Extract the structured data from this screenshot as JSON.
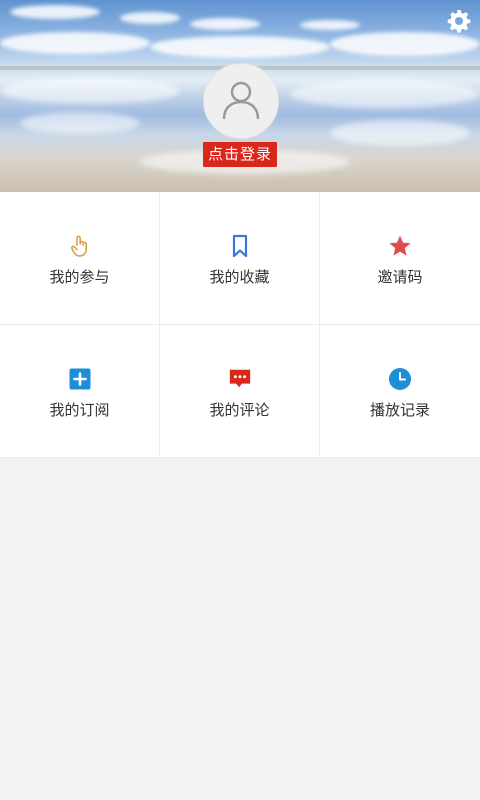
{
  "header": {
    "login_label": "点击登录",
    "accent_color": "#d9271c"
  },
  "menu": {
    "items": [
      {
        "label": "我的参与",
        "icon": "hand-pointer-icon",
        "color": "#d9a04a"
      },
      {
        "label": "我的收藏",
        "icon": "bookmark-icon",
        "color": "#3a78d6"
      },
      {
        "label": "邀请码",
        "icon": "star-icon",
        "color": "#e04b4b"
      },
      {
        "label": "我的订阅",
        "icon": "plus-square-icon",
        "color": "#1e8fd6"
      },
      {
        "label": "我的评论",
        "icon": "comment-icon",
        "color": "#d9271c"
      },
      {
        "label": "播放记录",
        "icon": "clock-icon",
        "color": "#1e8fd6"
      }
    ]
  }
}
